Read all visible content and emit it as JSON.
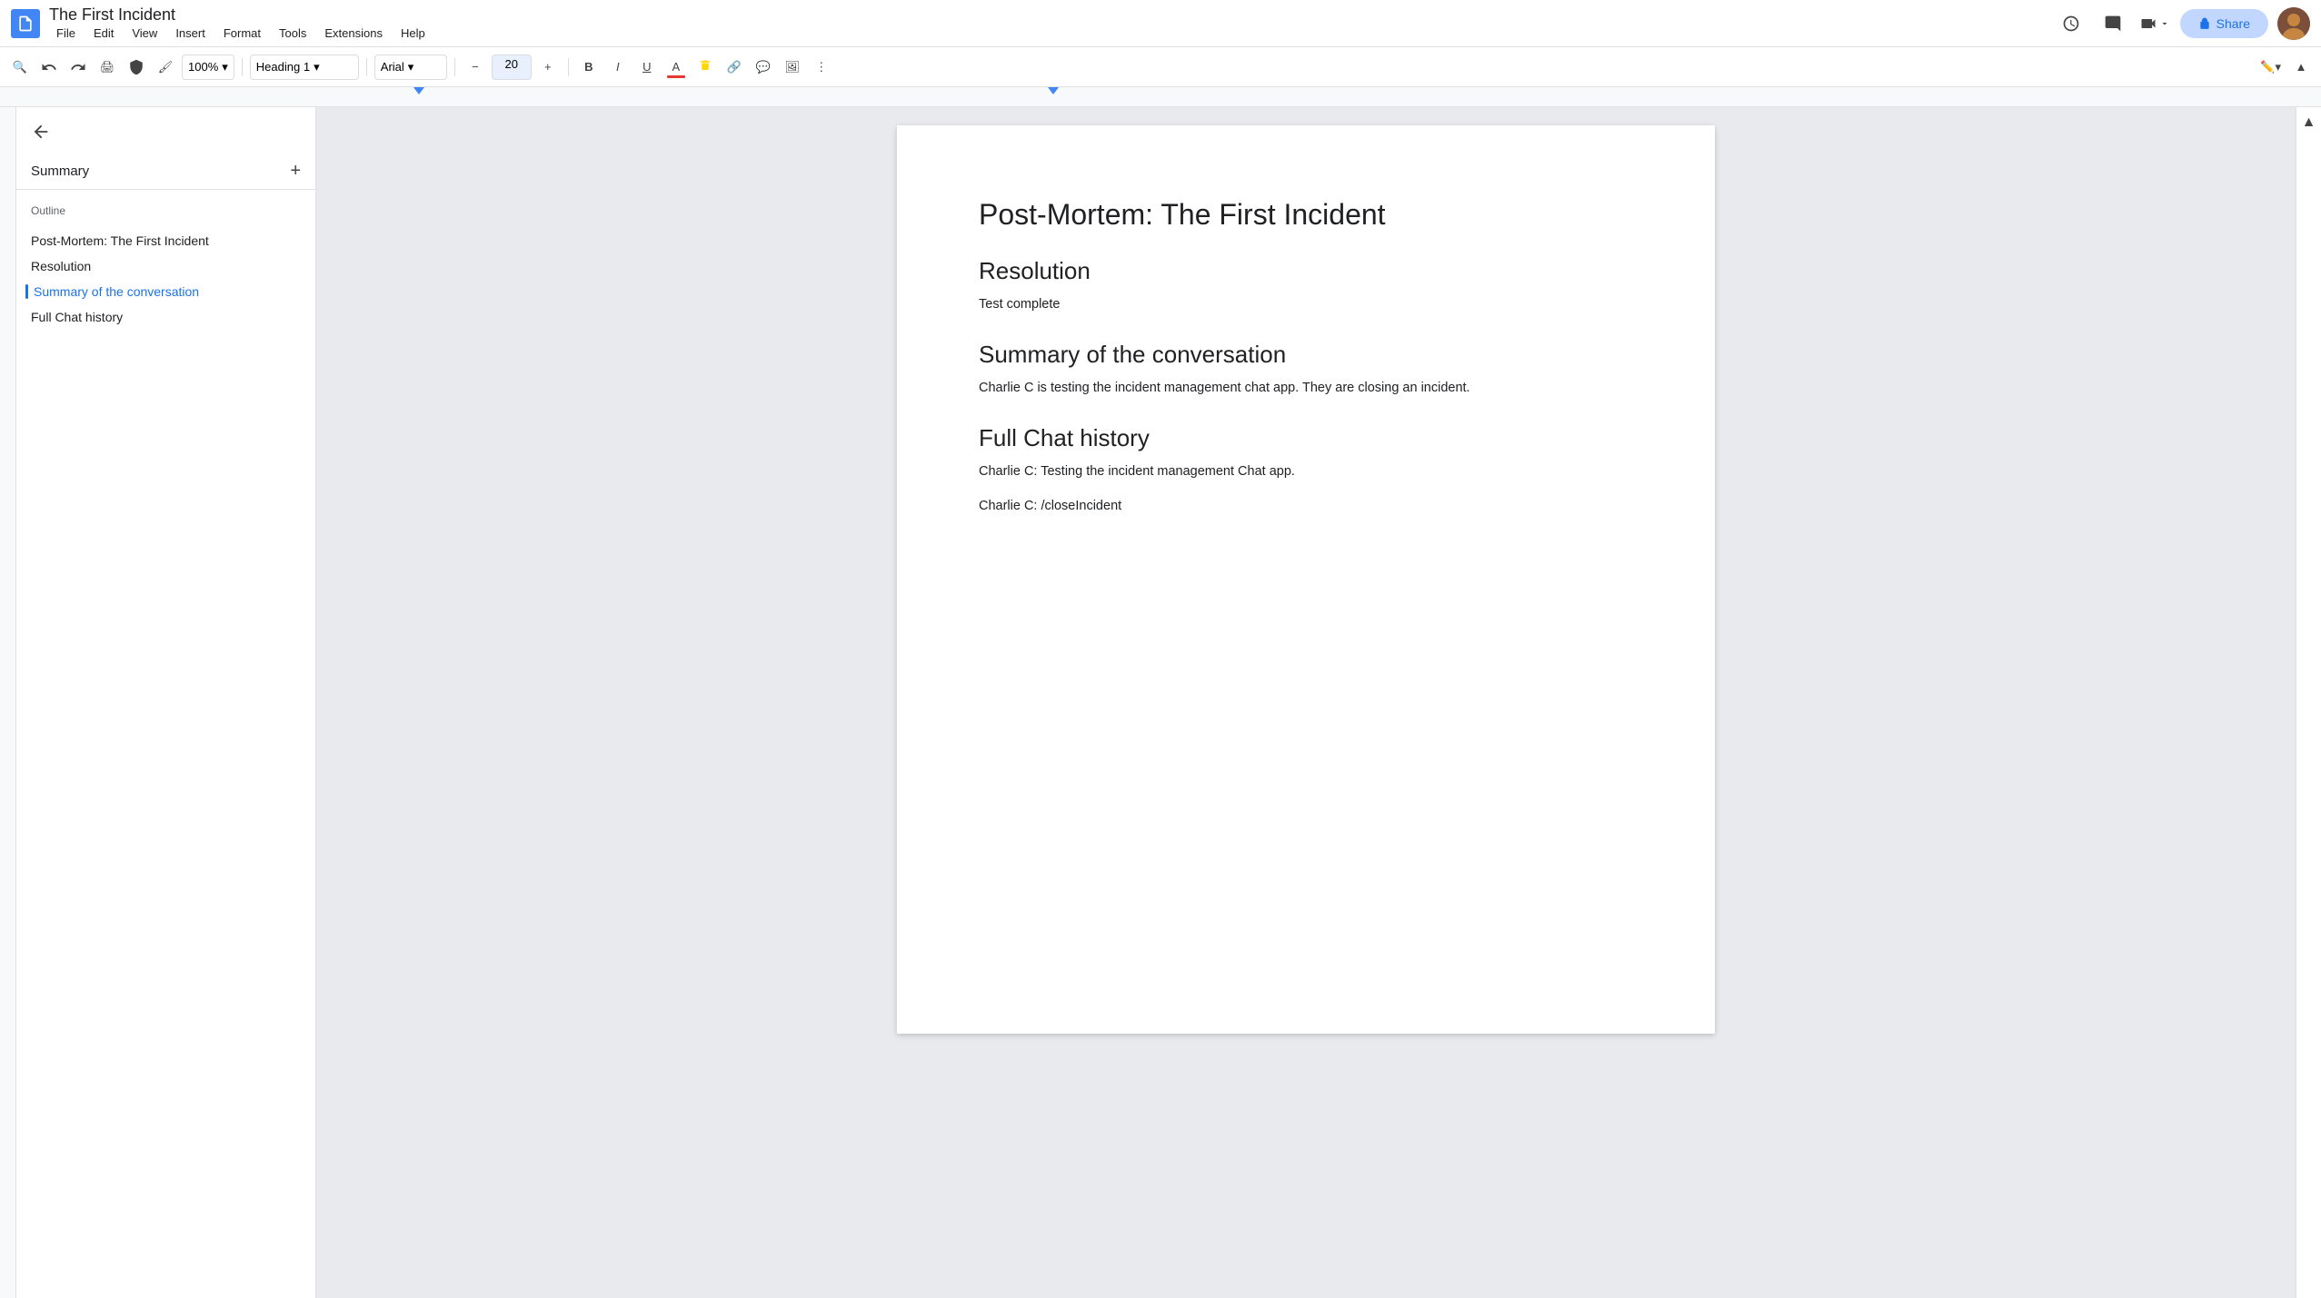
{
  "titleBar": {
    "docTitle": "The First Incident",
    "menuItems": [
      "File",
      "Edit",
      "View",
      "Insert",
      "Format",
      "Tools",
      "Extensions",
      "Help"
    ],
    "shareLabel": "Share"
  },
  "toolbar": {
    "zoom": "100%",
    "style": "Heading 1",
    "font": "Arial",
    "fontSize": "20",
    "boldLabel": "B",
    "italicLabel": "I",
    "underlineLabel": "U"
  },
  "sidebar": {
    "summaryLabel": "Summary",
    "outlineLabel": "Outline",
    "outlineItems": [
      {
        "id": "outline-title",
        "label": "Post-Mortem: The First Incident",
        "active": false
      },
      {
        "id": "outline-resolution",
        "label": "Resolution",
        "active": false
      },
      {
        "id": "outline-summary",
        "label": "Summary of the conversation",
        "active": true
      },
      {
        "id": "outline-chat",
        "label": "Full Chat history",
        "active": false
      }
    ]
  },
  "document": {
    "title": "Post-Mortem: The First Incident",
    "sections": [
      {
        "heading": "Resolution",
        "body": "Test complete"
      },
      {
        "heading": "Summary of the conversation",
        "body": "Charlie C is testing the incident management chat app. They are closing an incident."
      },
      {
        "heading": "Full Chat history",
        "lines": [
          "Charlie C: Testing the incident management Chat app.",
          "Charlie C: /closeIncident"
        ]
      }
    ]
  }
}
